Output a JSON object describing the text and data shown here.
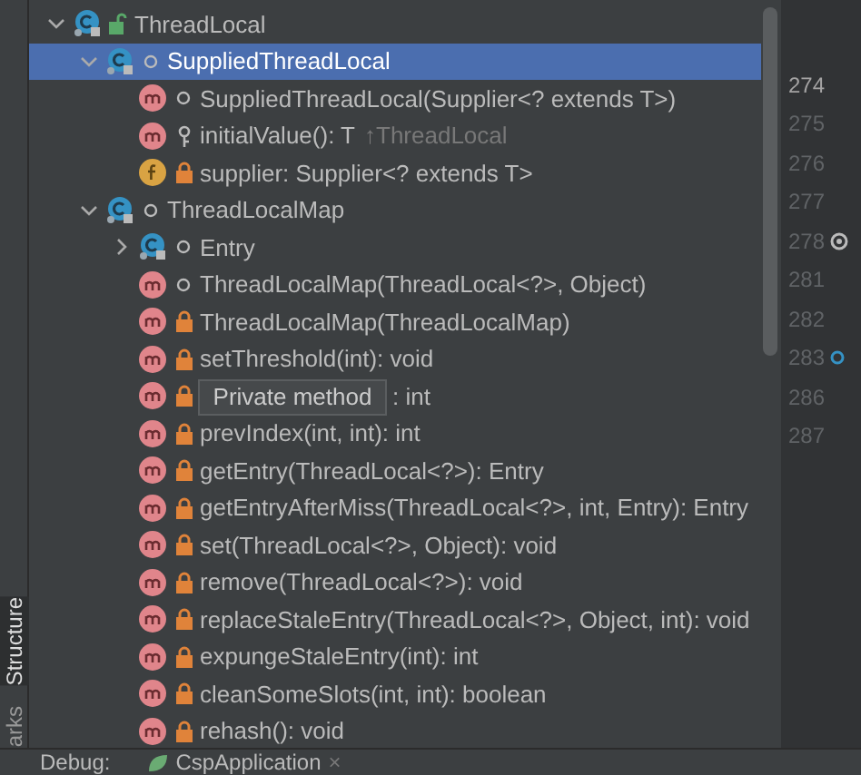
{
  "side_tabs": [
    {
      "label": "Structure",
      "selected": true
    },
    {
      "label": "arks",
      "selected": false
    }
  ],
  "tree": [
    {
      "kind": "class",
      "modifier": {
        "kind": "public"
      },
      "label": "ThreadLocal",
      "expanded": true,
      "selected": false,
      "children": [
        {
          "kind": "class",
          "modifier": {
            "kind": "package"
          },
          "label": "SuppliedThreadLocal",
          "expanded": true,
          "selected": true,
          "children": [
            {
              "kind": "method",
              "modifier": {
                "kind": "package"
              },
              "label": "SuppliedThreadLocal(Supplier<? extends T>)",
              "selected": false
            },
            {
              "kind": "method",
              "modifier": {
                "kind": "protected"
              },
              "label": "initialValue(): T",
              "inherited": "↑ThreadLocal",
              "selected": false
            },
            {
              "kind": "field",
              "modifier": {
                "kind": "private"
              },
              "label": "supplier: Supplier<? extends T>",
              "selected": false
            }
          ]
        },
        {
          "kind": "class",
          "modifier": {
            "kind": "package"
          },
          "label": "ThreadLocalMap",
          "expanded": true,
          "selected": false,
          "children": [
            {
              "kind": "class",
              "modifier": {
                "kind": "package"
              },
              "label": "Entry",
              "expanded": false,
              "selected": false
            },
            {
              "kind": "method",
              "modifier": {
                "kind": "package"
              },
              "label": "ThreadLocalMap(ThreadLocal<?>, Object)",
              "selected": false
            },
            {
              "kind": "method",
              "modifier": {
                "kind": "private"
              },
              "label": "ThreadLocalMap(ThreadLocalMap)",
              "selected": false
            },
            {
              "kind": "method",
              "modifier": {
                "kind": "private"
              },
              "label": "setThreshold(int): void",
              "selected": false
            },
            {
              "kind": "method",
              "modifier": {
                "kind": "private"
              },
              "label": ": int",
              "covered": true,
              "selected": false
            },
            {
              "kind": "method",
              "modifier": {
                "kind": "private"
              },
              "label": "prevIndex(int, int): int",
              "selected": false
            },
            {
              "kind": "method",
              "modifier": {
                "kind": "private"
              },
              "label": "getEntry(ThreadLocal<?>): Entry",
              "selected": false
            },
            {
              "kind": "method",
              "modifier": {
                "kind": "private"
              },
              "label": "getEntryAfterMiss(ThreadLocal<?>, int, Entry): Entry",
              "selected": false
            },
            {
              "kind": "method",
              "modifier": {
                "kind": "private"
              },
              "label": "set(ThreadLocal<?>, Object): void",
              "selected": false
            },
            {
              "kind": "method",
              "modifier": {
                "kind": "private"
              },
              "label": "remove(ThreadLocal<?>): void",
              "selected": false
            },
            {
              "kind": "method",
              "modifier": {
                "kind": "private"
              },
              "label": "replaceStaleEntry(ThreadLocal<?>, Object, int): void",
              "selected": false
            },
            {
              "kind": "method",
              "modifier": {
                "kind": "private"
              },
              "label": "expungeStaleEntry(int): int",
              "selected": false
            },
            {
              "kind": "method",
              "modifier": {
                "kind": "private"
              },
              "label": "cleanSomeSlots(int, int): boolean",
              "selected": false
            },
            {
              "kind": "method",
              "modifier": {
                "kind": "private"
              },
              "label": "rehash(): void",
              "selected": false
            }
          ]
        }
      ]
    }
  ],
  "tooltip": "Private method",
  "gutter": [
    {
      "number": "274",
      "current": true
    },
    {
      "number": "275",
      "current": false
    },
    {
      "number": "276",
      "current": false
    },
    {
      "number": "277",
      "current": false
    },
    {
      "number": "278",
      "current": false,
      "marker": {
        "kind": "override"
      }
    },
    {
      "number": "281",
      "current": false
    },
    {
      "number": "282",
      "current": false
    },
    {
      "number": "283",
      "current": false,
      "marker": {
        "kind": "breakpoint"
      }
    },
    {
      "number": "286",
      "current": false
    },
    {
      "number": "287",
      "current": false
    }
  ],
  "bottom_bar": {
    "label": "Debug:",
    "tab": "CspApplication",
    "close": "×"
  }
}
